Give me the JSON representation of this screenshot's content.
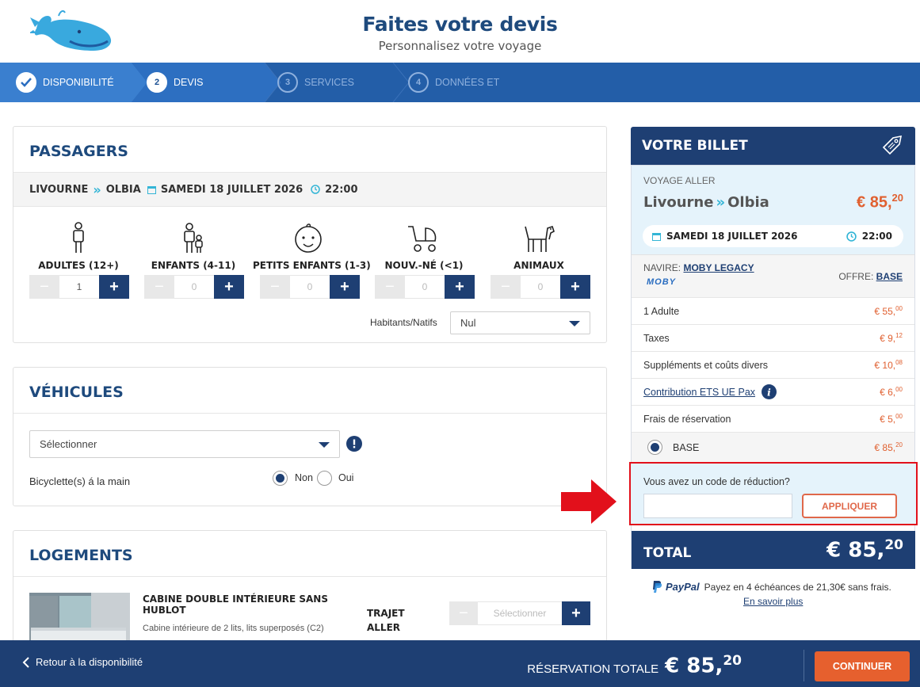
{
  "header": {
    "title": "Faites votre devis",
    "subtitle": "Personnalisez votre voyage"
  },
  "steps": [
    {
      "num": "",
      "label": "DISPONIBILITÉ",
      "state": "done"
    },
    {
      "num": "2",
      "label": "DEVIS",
      "state": "active"
    },
    {
      "num": "3",
      "label": "SERVICES",
      "state": "future"
    },
    {
      "num": "4",
      "label": "DONNÉES ET",
      "state": "future"
    }
  ],
  "passagers": {
    "title": "PASSAGERS",
    "route": {
      "from": "LIVOURNE",
      "to": "OLBIA",
      "date": "SAMEDI 18 JUILLET 2026",
      "time": "22:00"
    },
    "types": [
      {
        "label": "ADULTES (12+)",
        "value": "1",
        "icon": "adult-icon"
      },
      {
        "label": "ENFANTS (4-11)",
        "value": "0",
        "icon": "child-icon"
      },
      {
        "label": "PETITS ENFANTS (1-3)",
        "value": "0",
        "icon": "baby-face-icon"
      },
      {
        "label": "NOUV.-NÉ (<1)",
        "value": "0",
        "icon": "stroller-icon"
      },
      {
        "label": "ANIMAUX",
        "value": "0",
        "icon": "dog-icon"
      }
    ],
    "minus": "−",
    "plus": "+",
    "habitants_label": "Habitants/Natifs",
    "habitants_value": "Nul"
  },
  "vehicules": {
    "title": "VÉHICULES",
    "select_value": "Sélectionner",
    "bike_label": "Bicyclette(s) á la main",
    "opt_non": "Non",
    "opt_oui": "Oui"
  },
  "logements": {
    "title": "LOGEMENTS",
    "cabin_name": "CABINE DOUBLE INTÉRIEURE SANS HUBLOT",
    "cabin_desc": "Cabine intérieure de 2 lits, lits superposés (C2)",
    "trajet": "TRAJET ALLER",
    "select_value": "Sélectionner"
  },
  "ticket": {
    "title": "VOTRE BILLET",
    "voyage_label": "VOYAGE ALLER",
    "from": "Livourne",
    "to": "Olbia",
    "price_int": "€ 85,",
    "price_dec": "20",
    "date": "SAMEDI 18 JUILLET 2026",
    "time": "22:00",
    "navire_label": "NAVIRE: ",
    "navire_name": "MOBY LEGACY",
    "brand": "MOBY",
    "offre_label": "OFFRE: ",
    "offre_value": "BASE",
    "lines": [
      {
        "label": "1 Adulte",
        "int": "€ 55,",
        "dec": "00"
      },
      {
        "label": "Taxes",
        "int": "€ 9,",
        "dec": "12"
      },
      {
        "label": "Suppléments et coûts divers",
        "int": "€ 10,",
        "dec": "08"
      },
      {
        "label": "Contribution ETS UE Pax",
        "int": "€ 6,",
        "dec": "00"
      },
      {
        "label": "Frais de réservation",
        "int": "€ 5,",
        "dec": "00"
      },
      {
        "label": "BASE",
        "int": "€ 85,",
        "dec": "20"
      }
    ],
    "promo_question": "Vous avez un code de réduction?",
    "promo_placeholder": "",
    "promo_button": "APPLIQUER",
    "total_label": "TOTAL",
    "total_int": "€ 85,",
    "total_dec": "20",
    "paypal_brand": "PayPal",
    "paypal_text": "Payez en 4 échéances de 21,30€ sans frais.",
    "paypal_link": "En savoir plus"
  },
  "bottom": {
    "back": "Retour à la disponibilité",
    "total_label": "RÉSERVATION TOTALE",
    "total_int": "€ 85,",
    "total_dec": "20",
    "continue": "CONTINUER"
  },
  "colors": {
    "brand_blue": "#1e3f73",
    "step_blue": "#235ea8",
    "accent_orange": "#e06030",
    "highlight_red": "#e2101b"
  }
}
